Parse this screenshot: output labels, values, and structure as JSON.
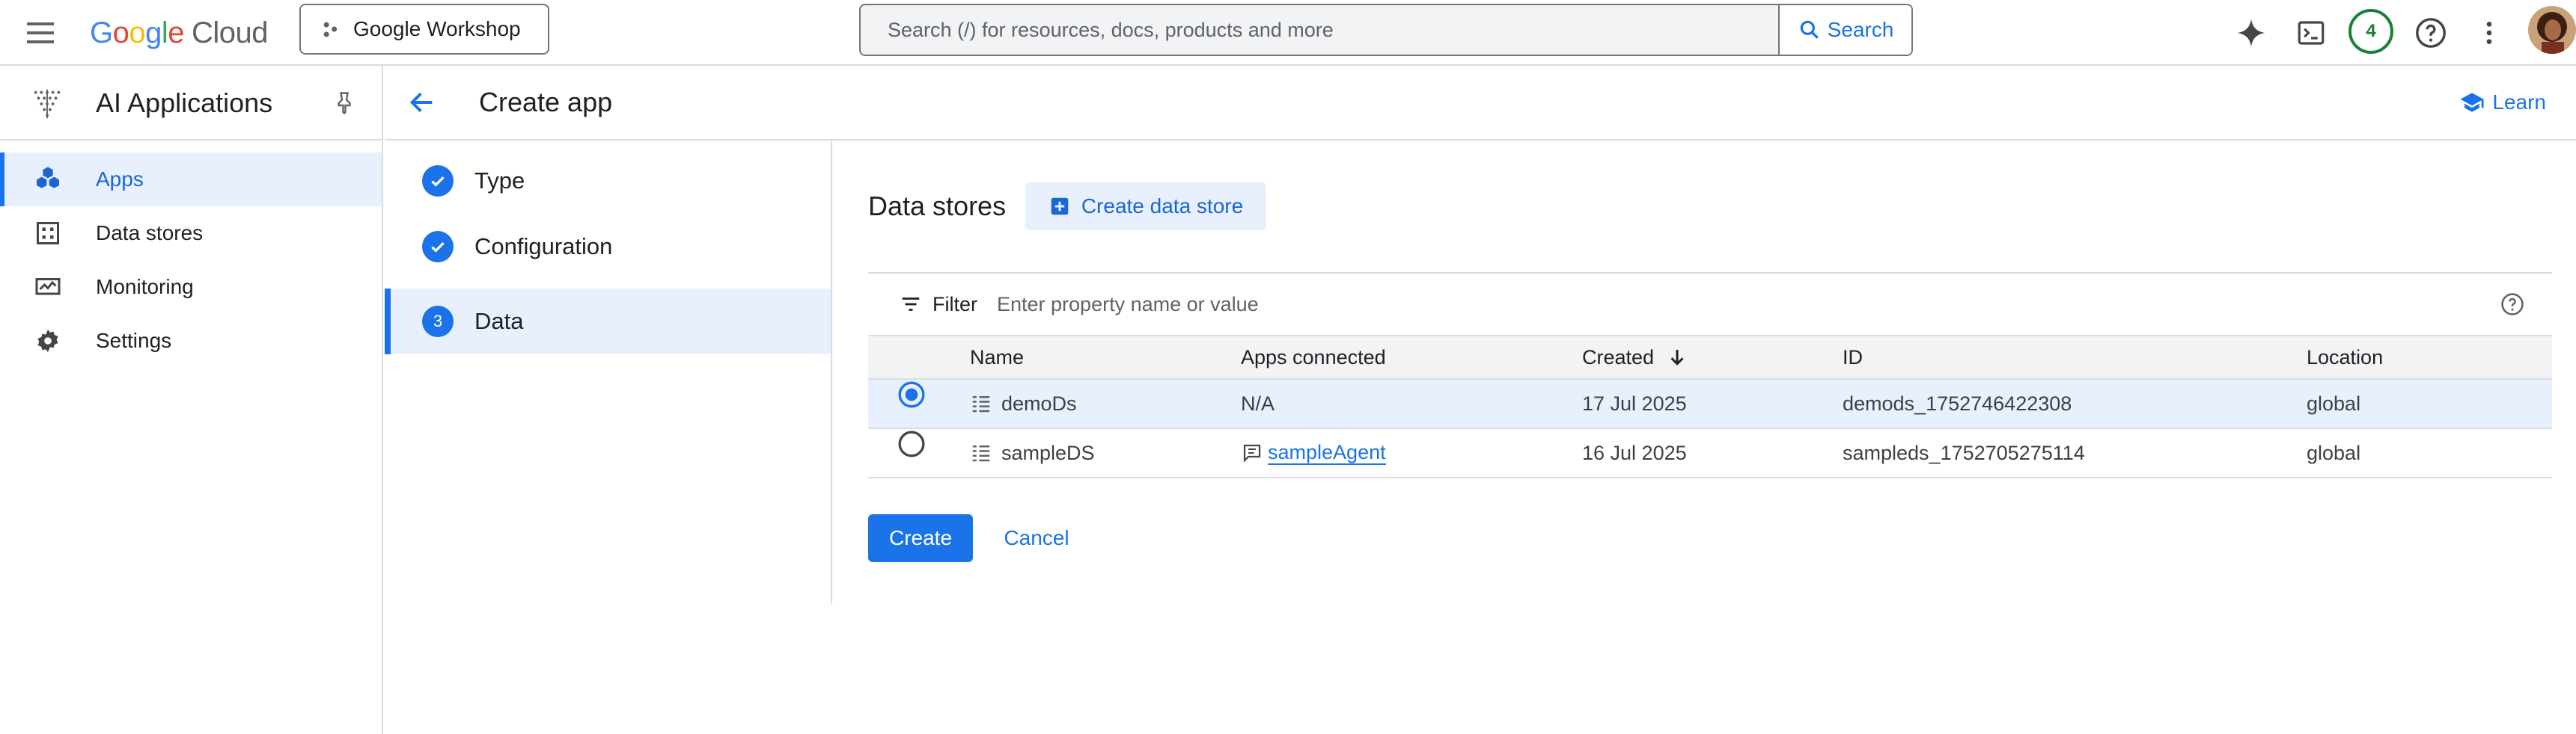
{
  "topbar": {
    "logo": {
      "g1": "G",
      "o1": "o",
      "o2": "o",
      "g2": "g",
      "l": "l",
      "e": "e",
      "cloud": "Cloud"
    },
    "project_label": "Google Workshop",
    "search_placeholder": "Search (/) for resources, docs, products and more",
    "search_button": "Search",
    "notifications_count": "4",
    "icons": [
      "menu-icon",
      "project-icon",
      "search-icon",
      "gemini-sparkle-icon",
      "terminal-icon",
      "help-icon",
      "more-vert-icon"
    ]
  },
  "sidebar": {
    "product_title": "AI Applications",
    "items": [
      {
        "label": "Apps",
        "icon": "apps-icon",
        "active": true
      },
      {
        "label": "Data stores",
        "icon": "data-stores-icon"
      },
      {
        "label": "Monitoring",
        "icon": "monitoring-icon"
      },
      {
        "label": "Settings",
        "icon": "settings-icon"
      }
    ]
  },
  "header": {
    "title": "Create app",
    "learn": "Learn"
  },
  "stepper": {
    "steps": [
      {
        "label": "Type",
        "state": "done"
      },
      {
        "label": "Configuration",
        "state": "done"
      },
      {
        "label": "Data",
        "number": "3",
        "state": "active"
      }
    ]
  },
  "datastores": {
    "title": "Data stores",
    "create_button": "Create data store",
    "filter_label": "Filter",
    "filter_placeholder": "Enter property name or value",
    "columns": {
      "name": "Name",
      "apps": "Apps connected",
      "created": "Created",
      "id": "ID",
      "location": "Location"
    },
    "rows": [
      {
        "selected": true,
        "name": "demoDs",
        "apps": "N/A",
        "created": "17 Jul 2025",
        "id": "demods_1752746422308",
        "location": "global"
      },
      {
        "selected": false,
        "name": "sampleDS",
        "apps": "sampleAgent",
        "created": "16 Jul 2025",
        "id": "sampleds_1752705275114",
        "location": "global"
      }
    ]
  },
  "actions": {
    "create": "Create",
    "cancel": "Cancel"
  },
  "colors": {
    "accent": "#1a73e8",
    "selected_bg": "#e8f0fe",
    "badge_green": "#188038"
  }
}
